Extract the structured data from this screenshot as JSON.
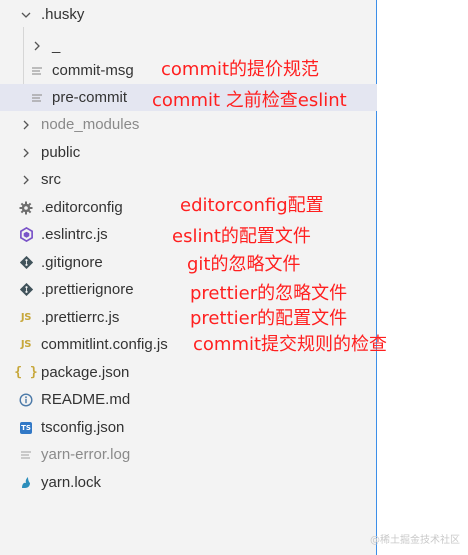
{
  "explorer": {
    "rows": [
      {
        "label": ".husky",
        "icon": "chevron-down"
      },
      {
        "label": "_",
        "icon": "chevron-right"
      },
      {
        "label": "commit-msg",
        "icon": "file-lines"
      },
      {
        "label": "pre-commit",
        "icon": "file-lines"
      },
      {
        "label": "node_modules",
        "icon": "chevron-right"
      },
      {
        "label": "public",
        "icon": "chevron-right"
      },
      {
        "label": "src",
        "icon": "chevron-right"
      },
      {
        "label": ".editorconfig",
        "icon": "gear"
      },
      {
        "label": ".eslintrc.js",
        "icon": "eslint"
      },
      {
        "label": ".gitignore",
        "icon": "git"
      },
      {
        "label": ".prettierignore",
        "icon": "git"
      },
      {
        "label": ".prettierrc.js",
        "icon": "js"
      },
      {
        "label": "commitlint.config.js",
        "icon": "js"
      },
      {
        "label": "package.json",
        "icon": "json"
      },
      {
        "label": "README.md",
        "icon": "info"
      },
      {
        "label": "tsconfig.json",
        "icon": "ts"
      },
      {
        "label": "yarn-error.log",
        "icon": "file-lines"
      },
      {
        "label": "yarn.lock",
        "icon": "yarn"
      }
    ],
    "icon_text": {
      "js": "JS",
      "ts": "TS",
      "json": "{ }"
    }
  },
  "annotations": {
    "commit_msg": "commit的提价规范",
    "pre_commit": "commit 之前检查eslint",
    "editorconfig": "editorconfig配置",
    "eslintrc": "eslint的配置文件",
    "gitignore": "git的忽略文件",
    "prettierignore": "prettier的忽略文件",
    "prettierrc": "prettier的配置文件",
    "commitlint": "commit提交规则的检查"
  },
  "watermark": "@稀土掘金技术社区",
  "colors": {
    "annotation": "#ff1f1f",
    "selected_row": "#e4e6f1",
    "border": "#3c8ee8"
  }
}
